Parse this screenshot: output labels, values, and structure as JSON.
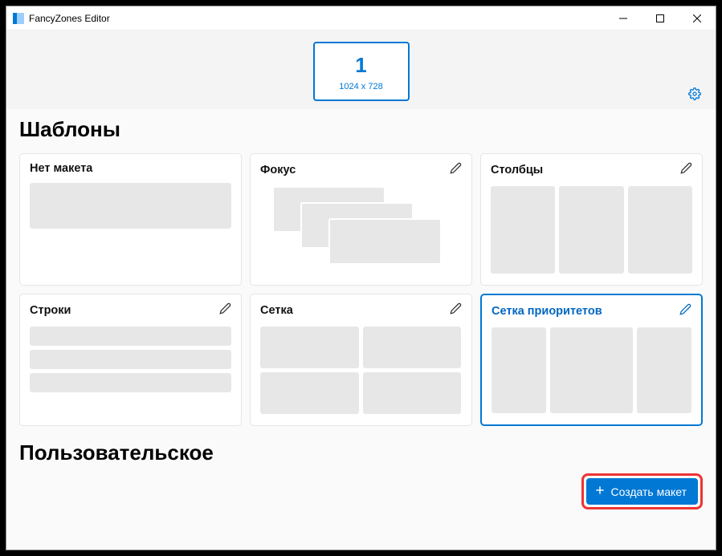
{
  "window": {
    "title": "FancyZones Editor"
  },
  "monitor": {
    "number": "1",
    "resolution": "1024 x 728"
  },
  "sections": {
    "templates": "Шаблоны",
    "custom": "Пользовательское"
  },
  "layouts": [
    {
      "name": "Нет макета"
    },
    {
      "name": "Фокус"
    },
    {
      "name": "Столбцы"
    },
    {
      "name": "Строки"
    },
    {
      "name": "Сетка"
    },
    {
      "name": "Сетка приоритетов"
    }
  ],
  "buttons": {
    "create": "Создать макет"
  }
}
